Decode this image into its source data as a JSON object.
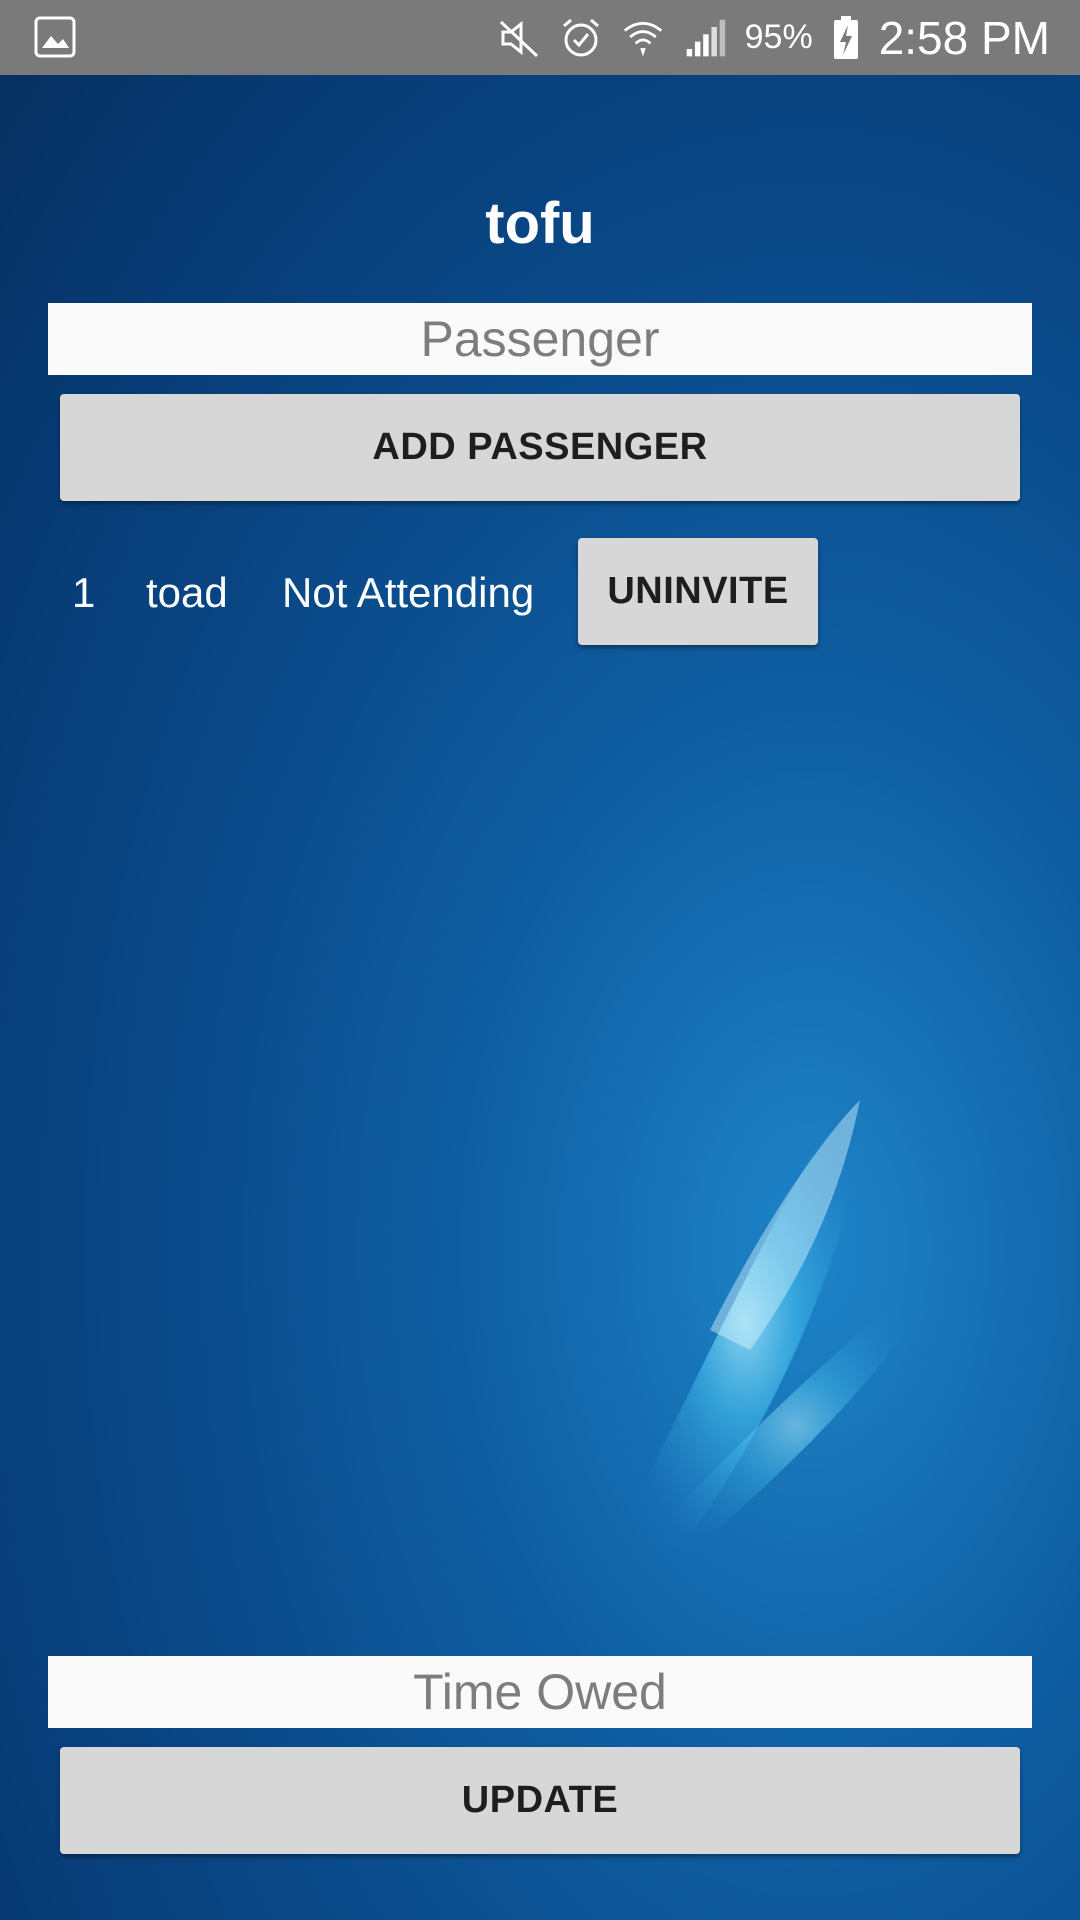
{
  "status_bar": {
    "battery_percent": "95%",
    "time": "2:58 PM",
    "icons": [
      "image-icon",
      "mute-icon",
      "alarm-icon",
      "wifi-icon",
      "signal-icon",
      "battery-charging-icon"
    ]
  },
  "title": "tofu",
  "passenger_input": {
    "placeholder": "Passenger",
    "value": ""
  },
  "add_passenger_label": "ADD PASSENGER",
  "passengers": [
    {
      "number": "1",
      "name": "toad",
      "status": "Not Attending",
      "action_label": "UNINVITE"
    }
  ],
  "time_owed_input": {
    "placeholder": "Time Owed",
    "value": ""
  },
  "update_label": "UPDATE",
  "colors": {
    "status_bar": "#7a7a7a",
    "background": "#0a4a8a",
    "button": "#d7d7d7",
    "input": "#fafafa"
  }
}
